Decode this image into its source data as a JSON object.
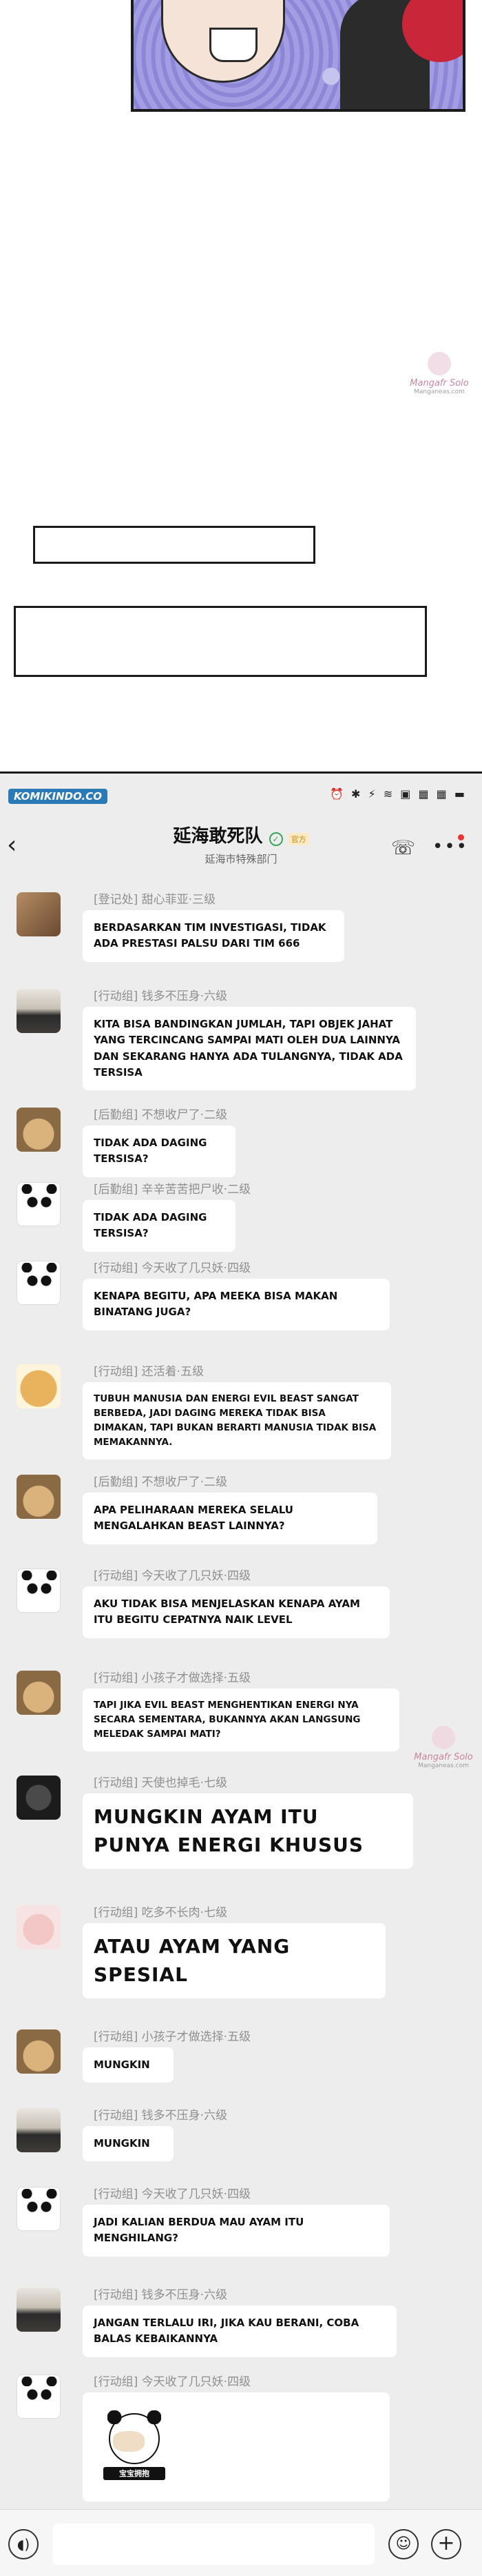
{
  "comic": {
    "watermark_top": "Mangafr Solo",
    "watermark_sub": "Manganeas.com"
  },
  "statusbar": {
    "source_badge": "KOMIKINDO.CO",
    "icons": "⏰ ✱ ⚡ ≋ ▣ ▦ ▦ ▬"
  },
  "header": {
    "back_icon": "‹",
    "title": "延海敢死队",
    "verified_badge": "✓",
    "tag": "官方",
    "subtitle": "延海市特殊部门",
    "call_icon": "☏",
    "more_icon": "•••"
  },
  "messages": [
    {
      "sender": "[登记处] 甜心菲亚·三级",
      "text": "BERDASARKAN TIM INVESTIGASI, TIDAK ADA PRESTASI PALSU DARI TIM 666",
      "avatar": "photo-avatar"
    },
    {
      "sender": "[行动组] 钱多不压身·六级",
      "text": "KITA BISA BANDINGKAN JUMLAH, TAPI OBJEK JAHAT YANG TERCINCANG SAMPAI MATI OLEH DUA LAINNYA DAN SEKARANG HANYA ADA TULANGNYA, TIDAK ADA TERSISA",
      "avatar": "ocean-avatar"
    },
    {
      "sender": "[后勤组] 不想收尸了·二级",
      "text": "TIDAK ADA DAGING TERSISA?",
      "avatar": "cat-avatar"
    },
    {
      "sender": "[后勤组] 辛辛苦苦把尸收·二级",
      "text": "TIDAK ADA DAGING TERSISA?",
      "avatar": "panda-avatar"
    },
    {
      "sender": "[行动组] 今天收了几只妖·四级",
      "text": "KENAPA BEGITU, APA MEEKA BISA MAKAN BINATANG JUGA?",
      "avatar": "panda-avatar"
    },
    {
      "sender": "[行动组] 还活着·五级",
      "text": "TUBUH MANUSIA DAN ENERGI EVIL BEAST SANGAT BERBEDA, JADI DAGING MEREKA TIDAK BISA DIMAKAN, TAPI BUKAN BERARTI MANUSIA TIDAK BISA MEMAKANNYA.",
      "avatar": "dog-avatar"
    },
    {
      "sender": "[后勤组] 不想收尸了·二级",
      "text": "APA PELIHARAAN MEREKA SELALU MENGALAHKAN BEAST LAINNYA?",
      "avatar": "cat-avatar"
    },
    {
      "sender": "[行动组] 今天收了几只妖·四级",
      "text": "AKU TIDAK BISA MENJELASKAN KENAPA AYAM ITU BEGITU CEPATNYA NAIK LEVEL",
      "avatar": "panda-avatar"
    },
    {
      "sender": "[行动组] 小孩子才做选择·五级",
      "text": "TAPI JIKA EVIL BEAST MENGHENTIKAN ENERGI NYA SECARA SEMENTARA, BUKANNYA AKAN LANGSUNG MELEDAK SAMPAI MATI?",
      "avatar": "cat-avatar"
    },
    {
      "sender": "[行动组] 天使也掉毛·七级",
      "text": "MUNGKIN AYAM ITU PUNYA ENERGI KHUSUS",
      "avatar": "dark-avatar"
    },
    {
      "sender": "[行动组] 吃多不长肉·七级",
      "text": "ATAU AYAM YANG SPESIAL",
      "avatar": "pink-avatar"
    },
    {
      "sender": "[行动组] 小孩子才做选择·五级",
      "text": "MUNGKIN",
      "avatar": "cat-avatar"
    },
    {
      "sender": "[行动组] 钱多不压身·六级",
      "text": "MUNGKIN",
      "avatar": "ocean-avatar"
    },
    {
      "sender": "[行动组] 今天收了几只妖·四级",
      "text": "JADI KALIAN BERDUA MAU AYAM ITU MENGHILANG?",
      "avatar": "panda-avatar"
    },
    {
      "sender": "[行动组] 钱多不压身·六级",
      "text": "JANGAN TERLALU IRI, JIKA KAU BERANI, COBA BALAS KEBAIKANNYA",
      "avatar": "ocean-avatar"
    },
    {
      "sender": "[行动组] 今天收了几只妖·四级",
      "text": "",
      "avatar": "panda-avatar",
      "sticker_caption": "宝宝拥抱"
    }
  ],
  "inputbar": {
    "voice_icon": "◖)",
    "placeholder": "",
    "emoji_icon": "☺",
    "plus_icon": "+"
  }
}
